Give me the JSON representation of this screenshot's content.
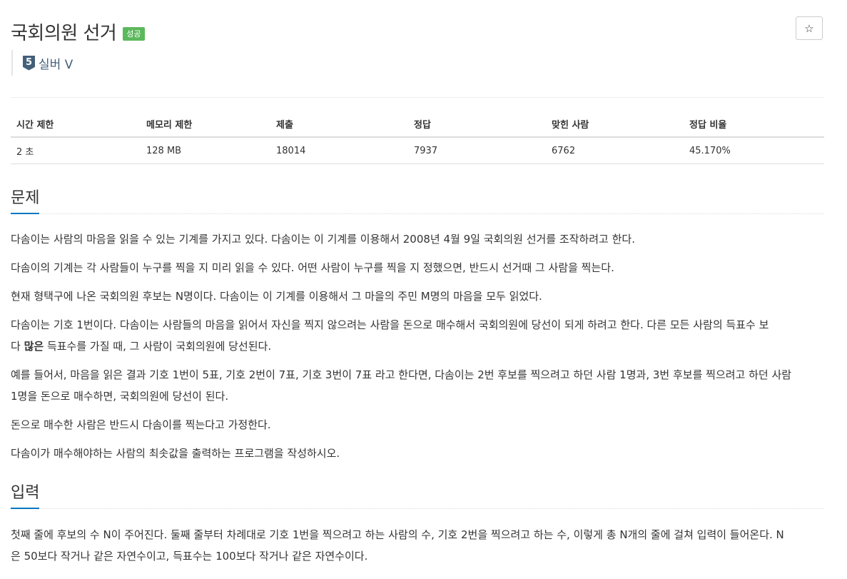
{
  "header": {
    "title": "국회의원 선거",
    "result_badge": "성공",
    "star_icon": "star-icon",
    "tier_number": "5",
    "tier_label": "실버 V"
  },
  "info_table": {
    "headers": [
      "시간 제한",
      "메모리 제한",
      "제출",
      "정답",
      "맞힌 사람",
      "정답 비율"
    ],
    "values": [
      "2 초",
      "128 MB",
      "18014",
      "7937",
      "6762",
      "45.170%"
    ]
  },
  "problem": {
    "heading": "문제",
    "paragraphs": [
      "다솜이는 사람의 마음을 읽을 수 있는 기계를 가지고 있다. 다솜이는 이 기계를 이용해서 2008년 4월 9일 국회의원 선거를 조작하려고 한다.",
      "다솜이의 기계는 각 사람들이 누구를 찍을 지 미리 읽을 수 있다. 어떤 사람이 누구를 찍을 지 정했으면, 반드시 선거때 그 사람을 찍는다.",
      "현재 형택구에 나온 국회의원 후보는 N명이다. 다솜이는 이 기계를 이용해서 그 마을의 주민 M명의 마음을 모두 읽었다."
    ],
    "para4_line1": "다솜이는 기호 1번이다. 다솜이는 사람들의 마음을 읽어서 자신을 찍지 않으려는 사람을 돈으로 매수해서 국회의원에 당선이 되게 하려고 한다. 다른 모든 사람의 득표수 보",
    "para4_pre": "다 ",
    "para4_bold": "많은",
    "para4_post": " 득표수를 가질 때, 그 사람이 국회의원에 당선된다.",
    "para5_line1": "예를 들어서, 마음을 읽은 결과 기호 1번이 5표, 기호 2번이 7표, 기호 3번이 7표 라고 한다면, 다솜이는 2번 후보를 찍으려고 하던 사람 1명과, 3번 후보를 찍으려고 하던 사람",
    "para5_line2": "1명을 돈으로 매수하면, 국회의원에 당선이 된다.",
    "para6": "돈으로 매수한 사람은 반드시 다솜이를 찍는다고 가정한다.",
    "para7": "다솜이가 매수해야하는 사람의 최솟값을 출력하는 프로그램을 작성하시오."
  },
  "input": {
    "heading": "입력",
    "line1": "첫째 줄에 후보의 수 N이 주어진다. 둘째 줄부터 차례대로 기호 1번을 찍으려고 하는 사람의 수, 기호 2번을 찍으려고 하는 수, 이렇게 총 N개의 줄에 걸쳐 입력이 들어온다. N",
    "line2": "은 50보다 작거나 같은 자연수이고, 득표수는 100보다 작거나 같은 자연수이다."
  },
  "colors": {
    "accent": "#0076c0",
    "success": "#5cb85c",
    "tier_silver": "#435f7a"
  }
}
